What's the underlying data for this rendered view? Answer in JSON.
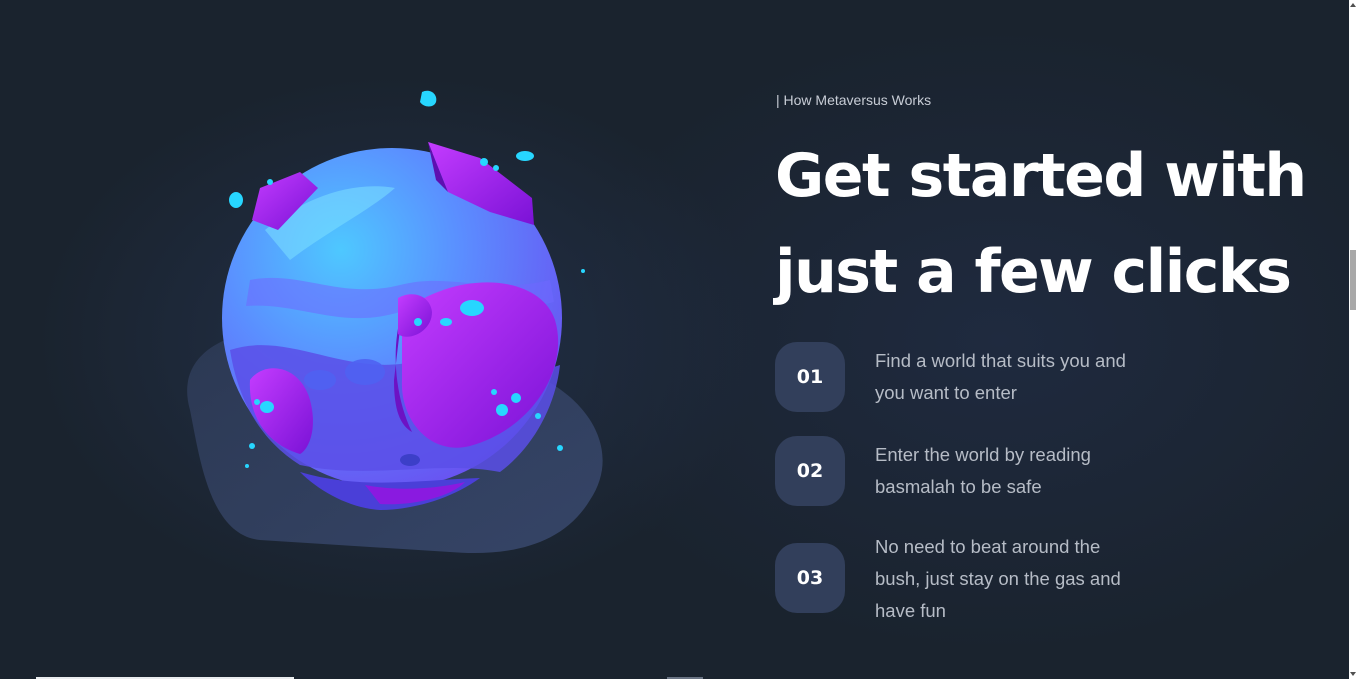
{
  "section": {
    "eyebrow": "| How Metaversus Works",
    "headline": "Get started with just a few clicks"
  },
  "steps": [
    {
      "number": "01",
      "text": "Find a world that suits you and you want to enter"
    },
    {
      "number": "02",
      "text": "Enter the world by reading basmalah to be safe"
    },
    {
      "number": "03",
      "text": "No need to beat around the bush, just stay on the gas and have fun"
    }
  ],
  "colors": {
    "background": "#1a232e",
    "badge": "#323f5b",
    "headline": "#ffffff",
    "body_text": "#b6bcc6",
    "planet_blue": "#5b8dff",
    "planet_purple": "#9a1fe6",
    "accent_cyan": "#27d6ff"
  },
  "icons": {
    "illustration": "planet-illustration"
  }
}
